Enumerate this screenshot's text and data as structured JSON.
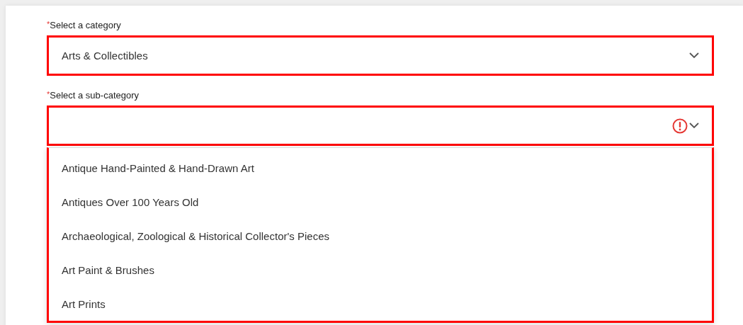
{
  "fields": [
    {
      "required_mark": "*",
      "label": "Select a category",
      "value": "Arts & Collectibles",
      "highlighted": true,
      "error": false
    },
    {
      "required_mark": "*",
      "label": "Select a sub-category",
      "highlighted": true,
      "error": true,
      "options": [
        {
          "label": "Antique Hand-Painted & Hand-Drawn Art"
        },
        {
          "label": "Antiques Over 100 Years Old"
        },
        {
          "label": "Archaeological, Zoological & Historical Collector's Pieces"
        },
        {
          "label": "Art Paint & Brushes"
        },
        {
          "label": "Art Prints"
        }
      ]
    }
  ]
}
